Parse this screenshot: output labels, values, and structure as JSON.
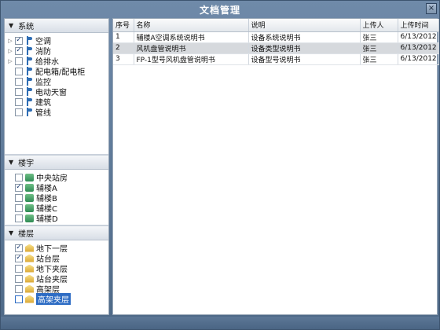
{
  "window": {
    "title": "文档管理",
    "close_label": "×"
  },
  "panels": {
    "system": {
      "header": "系统",
      "items": [
        {
          "label": "空调",
          "checked": true,
          "expandable": true
        },
        {
          "label": "消防",
          "checked": true,
          "expandable": true
        },
        {
          "label": "给排水",
          "checked": false,
          "expandable": true
        },
        {
          "label": "配电箱/配电柜",
          "checked": false,
          "expandable": false
        },
        {
          "label": "监控",
          "checked": false,
          "expandable": false
        },
        {
          "label": "电动天窗",
          "checked": false,
          "expandable": false
        },
        {
          "label": "建筑",
          "checked": false,
          "expandable": false
        },
        {
          "label": "管线",
          "checked": false,
          "expandable": false
        }
      ]
    },
    "building": {
      "header": "楼宇",
      "items": [
        {
          "label": "中央站房",
          "checked": false
        },
        {
          "label": "辅楼A",
          "checked": true
        },
        {
          "label": "辅楼B",
          "checked": false
        },
        {
          "label": "辅楼C",
          "checked": false
        },
        {
          "label": "辅楼D",
          "checked": false
        }
      ]
    },
    "floor": {
      "header": "楼层",
      "items": [
        {
          "label": "地下一层",
          "checked": true,
          "selected": false
        },
        {
          "label": "站台层",
          "checked": true,
          "selected": false
        },
        {
          "label": "地下夹层",
          "checked": false,
          "selected": false
        },
        {
          "label": "站台夹层",
          "checked": false,
          "selected": false
        },
        {
          "label": "高架层",
          "checked": false,
          "selected": false
        },
        {
          "label": "高架夹层",
          "checked": false,
          "selected": true
        }
      ]
    }
  },
  "table": {
    "columns": [
      "序号",
      "名称",
      "说明",
      "上传人",
      "上传时间"
    ],
    "rows": [
      {
        "cells": [
          "1",
          "辅楼A空调系统说明书",
          "设备系统说明书",
          "张三",
          "6/13/2012"
        ],
        "selected": false
      },
      {
        "cells": [
          "2",
          "风机盘管说明书",
          "设备类型说明书",
          "张三",
          "6/13/2012"
        ],
        "selected": true
      },
      {
        "cells": [
          "3",
          "FP-1型号风机盘管说明书",
          "设备型号说明书",
          "张三",
          "6/13/2012"
        ],
        "selected": false
      }
    ]
  }
}
